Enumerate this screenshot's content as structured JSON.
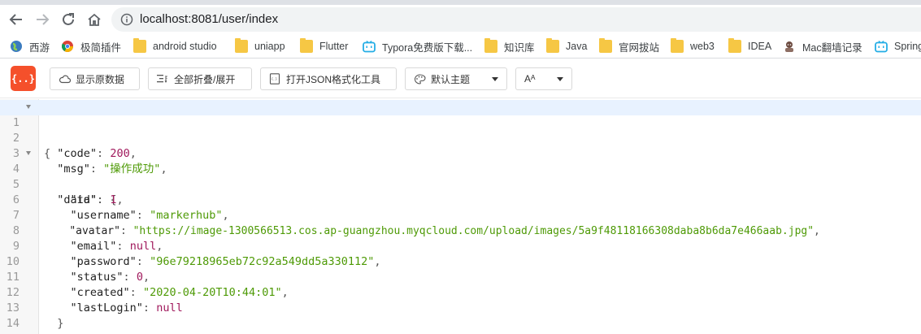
{
  "browser": {
    "url": "localhost:8081/user/index"
  },
  "bookmarks": [
    {
      "label": "西游",
      "icon": "globe-icon"
    },
    {
      "label": "极简插件",
      "icon": "chrome-icon"
    },
    {
      "label": "android studio",
      "icon": "folder-icon"
    },
    {
      "label": "uniapp",
      "icon": "folder-icon"
    },
    {
      "label": "Flutter",
      "icon": "folder-icon"
    },
    {
      "label": "Typora免费版下载...",
      "icon": "bilibili-icon"
    },
    {
      "label": "知识库",
      "icon": "folder-icon"
    },
    {
      "label": "Java",
      "icon": "folder-icon"
    },
    {
      "label": "官网拔站",
      "icon": "folder-icon"
    },
    {
      "label": "web3",
      "icon": "folder-icon"
    },
    {
      "label": "IDEA",
      "icon": "folder-icon"
    },
    {
      "label": "Mac翻墙记录",
      "icon": "avatar-icon"
    },
    {
      "label": "Spring",
      "icon": "bilibili-icon"
    }
  ],
  "toolbar": {
    "logo": "{..}",
    "raw_label": "显示原数据",
    "fold_label": "全部折叠/展开",
    "open_tool_label": "打开JSON格式化工具",
    "theme_label": "默认主题",
    "font_label": "Aᴬ"
  },
  "code": {
    "lines": [
      {
        "n": "1",
        "fold": true
      },
      {
        "n": "2",
        "fold": false
      },
      {
        "n": "3",
        "fold": false
      },
      {
        "n": "4",
        "fold": true
      },
      {
        "n": "5",
        "fold": false
      },
      {
        "n": "6",
        "fold": false
      },
      {
        "n": "7",
        "fold": false
      },
      {
        "n": "8",
        "fold": false
      },
      {
        "n": "9",
        "fold": false
      },
      {
        "n": "10",
        "fold": false
      },
      {
        "n": "11",
        "fold": false
      },
      {
        "n": "12",
        "fold": false
      },
      {
        "n": "13",
        "fold": false
      },
      {
        "n": "14",
        "fold": false
      }
    ],
    "open_brace": "{",
    "close_brace": "}",
    "code_key": "\"code\"",
    "code_val": "200",
    "msg_key": "\"msg\"",
    "msg_val": "\"操作成功\"",
    "data_key": "\"data\"",
    "data_open": "{",
    "data_close": "}",
    "id_key": "\"id\"",
    "id_val": "1",
    "username_key": "\"username\"",
    "username_val": "\"markerhub\"",
    "avatar_key": "\"avatar\"",
    "avatar_val": "\"https://image-1300566513.cos.ap-guangzhou.myqcloud.com/upload/images/5a9f48118166308daba8b6da7e466aab.jpg\"",
    "email_key": "\"email\"",
    "email_val": "null",
    "password_key": "\"password\"",
    "password_val": "\"96e79218965eb72c92a549dd5a330112\"",
    "status_key": "\"status\"",
    "status_val": "0",
    "created_key": "\"created\"",
    "created_val": "\"2020-04-20T10:44:01\"",
    "lastlogin_key": "\"lastLogin\"",
    "lastlogin_val": "null"
  }
}
